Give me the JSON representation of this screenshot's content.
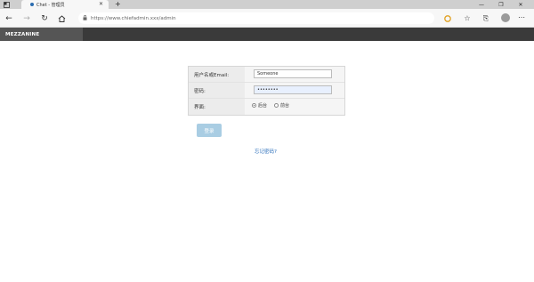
{
  "browser": {
    "tab_title": "Chet - 管理员",
    "new_tab": "+",
    "url": "https://www.chiefadmin.xxx/admin",
    "win_min": "—",
    "win_max": "❐",
    "win_close": "✕"
  },
  "app": {
    "brand": "MEZZANINE"
  },
  "login": {
    "username_label": "用户名或Email:",
    "username_value": "Someone",
    "password_label": "密码:",
    "password_value": "••••••••",
    "interface_label": "界面:",
    "interface_options": [
      "后台",
      "前台"
    ],
    "submit_label": "登录",
    "forgot_label": "忘记密码?"
  },
  "colors": {
    "header_bg": "#3a3a3a",
    "brand_bg": "#555555",
    "button_bg": "#a9cde3",
    "link": "#2a6ebb"
  }
}
